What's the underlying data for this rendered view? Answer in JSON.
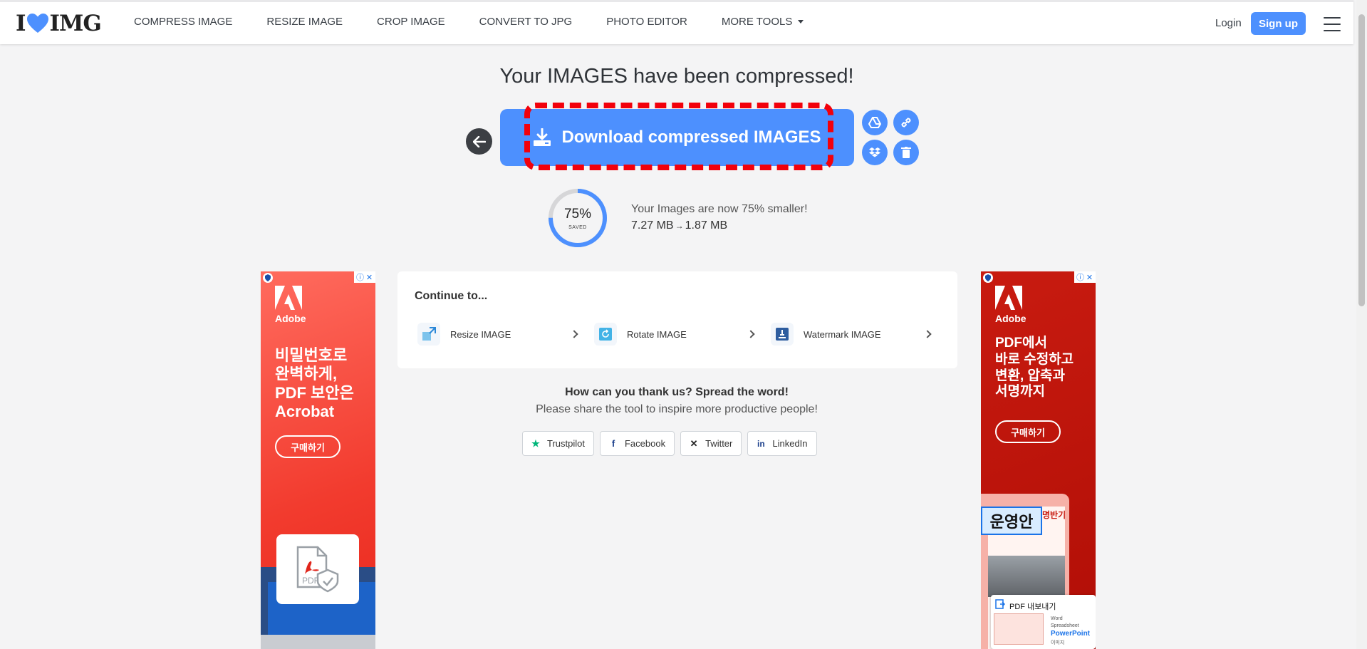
{
  "header": {
    "logo_text_left": "I",
    "logo_text_right": "IMG",
    "nav": [
      "COMPRESS IMAGE",
      "RESIZE IMAGE",
      "CROP IMAGE",
      "CONVERT TO JPG",
      "PHOTO EDITOR",
      "MORE TOOLS"
    ],
    "login": "Login",
    "signup": "Sign up"
  },
  "main": {
    "headline": "Your IMAGES have been compressed!",
    "download_label": "Download compressed IMAGES",
    "saved_percent": "75%",
    "saved_label": "SAVED",
    "smaller_text": "Your Images are now 75% smaller!",
    "size_before": "7.27 MB",
    "size_arrow": "→",
    "size_after": "1.87 MB",
    "continue_title": "Continue to...",
    "tools": [
      {
        "label": "Resize IMAGE",
        "icon": "resize-icon"
      },
      {
        "label": "Rotate IMAGE",
        "icon": "rotate-icon"
      },
      {
        "label": "Watermark IMAGE",
        "icon": "watermark-icon"
      }
    ],
    "thanks": "How can you thank us? Spread the word!",
    "share_text": "Please share the tool to inspire more productive people!",
    "share": [
      "Trustpilot",
      "Facebook",
      "Twitter",
      "LinkedIn"
    ]
  },
  "ads": {
    "left": {
      "brand": "Adobe",
      "copy": "비밀번호로\n완벽하게,\nPDF 보안은\nAcrobat",
      "cta": "구매하기",
      "pdf_label": "PDF"
    },
    "right": {
      "brand": "Adobe",
      "copy": "PDF에서\n바로 수정하고\n변환, 압축과\n서명까지",
      "cta": "구매하기",
      "highlight": "운영안",
      "tab_text": "명반기",
      "export_title": "PDF 내보내기",
      "export_options": [
        "Word",
        "Spreadsheet",
        "PowerPoint",
        "이미지"
      ]
    }
  },
  "colors": {
    "accent": "#4d90fe",
    "highlight_outline": "#f2000b",
    "page_bg": "#f4f4f5"
  }
}
